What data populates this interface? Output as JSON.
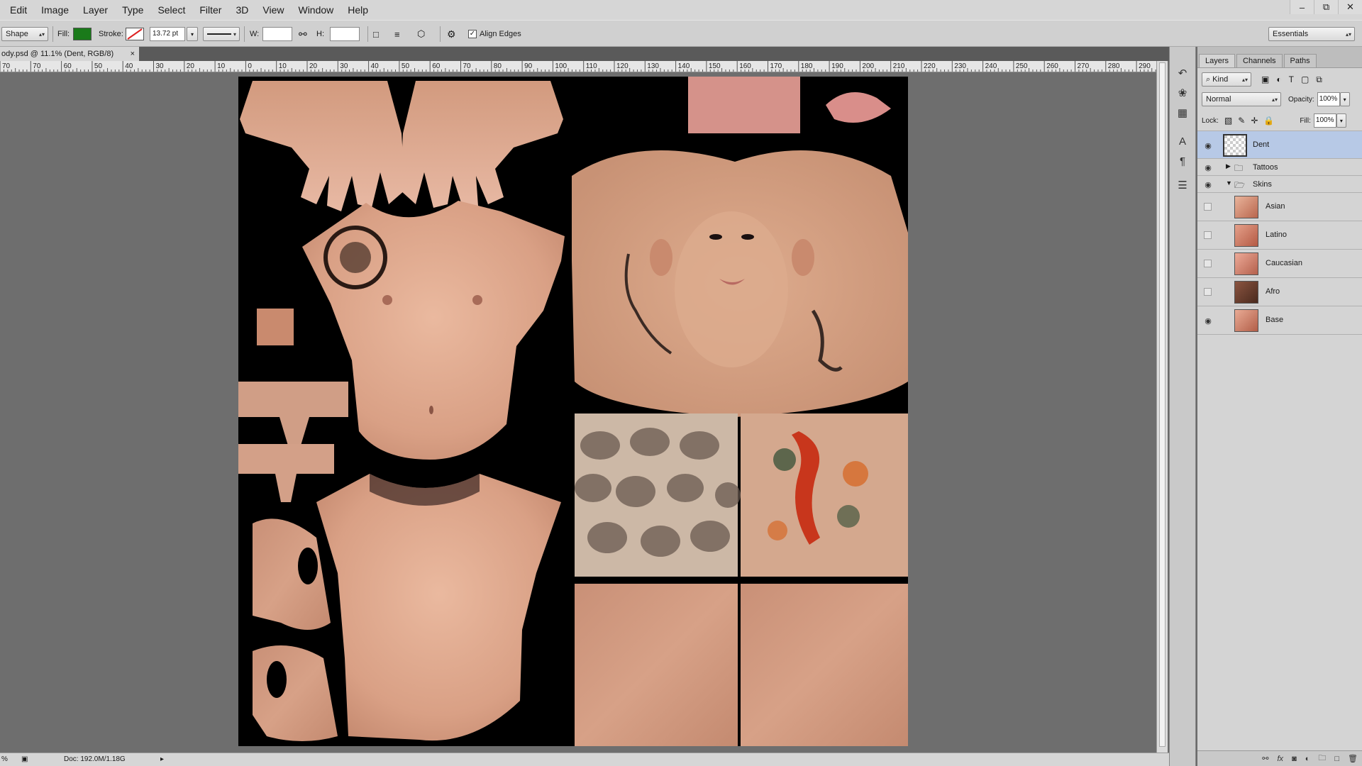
{
  "menu": [
    "Edit",
    "Image",
    "Layer",
    "Type",
    "Select",
    "Filter",
    "3D",
    "View",
    "Window",
    "Help"
  ],
  "window_controls": {
    "minimize": "–",
    "restore": "⧉",
    "close": "✕"
  },
  "options": {
    "tool_mode": "Shape",
    "fill_label": "Fill:",
    "fill_color": "#1a7a1a",
    "stroke_label": "Stroke:",
    "stroke_width": "13.72 pt",
    "w_label": "W:",
    "h_label": "H:",
    "align_edges_label": "Align Edges",
    "align_edges_checked": true,
    "workspace": "Essentials"
  },
  "document": {
    "tab_title": "ody.psd @ 11.1% (Dent, RGB/8)",
    "close": "×"
  },
  "ruler": {
    "labels": [
      "70",
      "70",
      "60",
      "50",
      "40",
      "30",
      "20",
      "10",
      "0",
      "10",
      "20",
      "30",
      "40",
      "50",
      "60",
      "70",
      "80",
      "90",
      "100",
      "110",
      "120",
      "130",
      "140",
      "150",
      "160",
      "170",
      "180",
      "190",
      "200",
      "210",
      "220",
      "230",
      "240",
      "250",
      "260",
      "270",
      "280",
      "290"
    ]
  },
  "status": {
    "zoom": "%",
    "doc_size": "Doc: 192.0M/1.18G"
  },
  "layers_panel": {
    "tabs": [
      "Layers",
      "Channels",
      "Paths"
    ],
    "filter_kind": "Kind",
    "blend_mode": "Normal",
    "opacity_label": "Opacity:",
    "opacity_value": "100%",
    "lock_label": "Lock:",
    "fill_label": "Fill:",
    "fill_value": "100%",
    "layers": [
      {
        "name": "Dent",
        "type": "layer",
        "visible": true,
        "selected": true
      },
      {
        "name": "Tattoos",
        "type": "group",
        "visible": true,
        "expanded": false
      },
      {
        "name": "Skins",
        "type": "group",
        "visible": true,
        "expanded": true
      },
      {
        "name": "Asian",
        "type": "layer",
        "visible": false
      },
      {
        "name": "Latino",
        "type": "layer",
        "visible": false
      },
      {
        "name": "Caucasian",
        "type": "layer",
        "visible": false
      },
      {
        "name": "Afro",
        "type": "layer",
        "visible": false
      },
      {
        "name": "Base",
        "type": "layer",
        "visible": true
      }
    ]
  },
  "colors": {
    "skin_light": "#e8b49a",
    "skin_mid": "#d4957a",
    "skin_dark": "#b87560",
    "selection": "#b7c9e6",
    "koi_red": "#c8361c"
  }
}
